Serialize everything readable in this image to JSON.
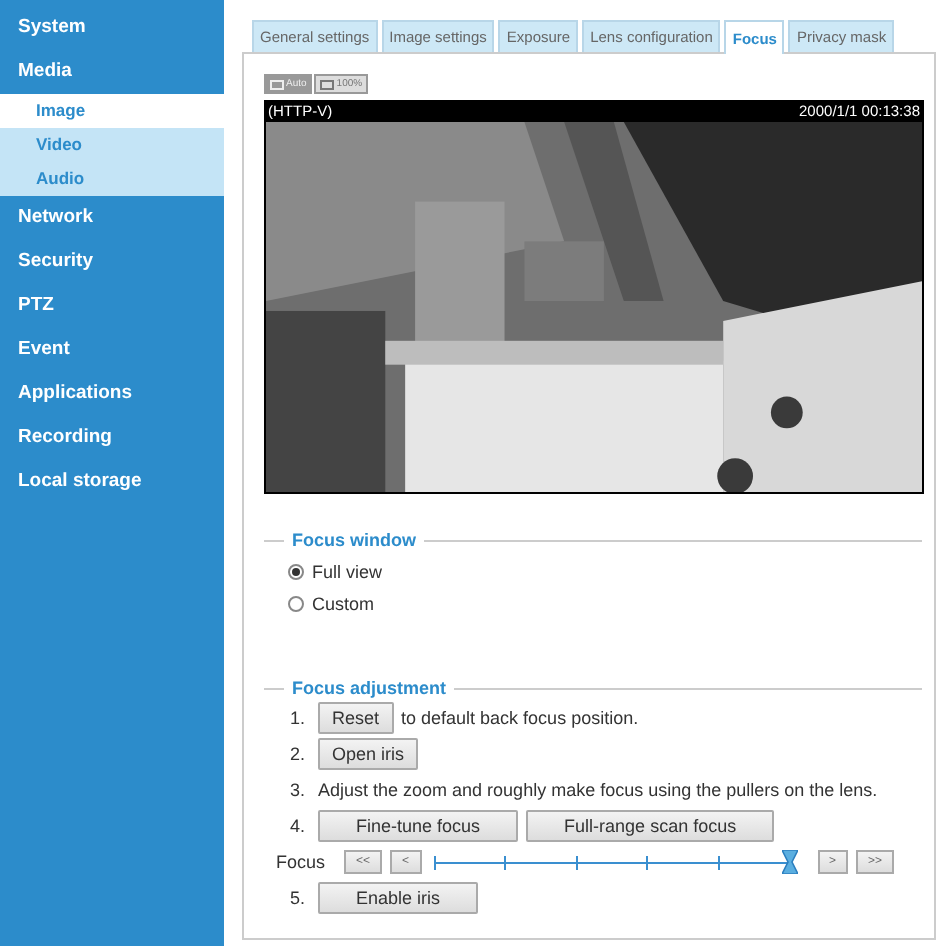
{
  "sidebar": {
    "items": [
      {
        "label": "System",
        "selected": false
      },
      {
        "label": "Media",
        "selected": false,
        "expanded": true,
        "children": [
          {
            "label": "Image",
            "selected": true
          },
          {
            "label": "Video",
            "selected": false
          },
          {
            "label": "Audio",
            "selected": false
          }
        ]
      },
      {
        "label": "Network",
        "selected": false
      },
      {
        "label": "Security",
        "selected": false
      },
      {
        "label": "PTZ",
        "selected": false
      },
      {
        "label": "Event",
        "selected": false
      },
      {
        "label": "Applications",
        "selected": false
      },
      {
        "label": "Recording",
        "selected": false
      },
      {
        "label": "Local storage",
        "selected": false
      }
    ]
  },
  "tabs": [
    {
      "label": "General settings",
      "selected": false
    },
    {
      "label": "Image settings",
      "selected": false
    },
    {
      "label": "Exposure",
      "selected": false
    },
    {
      "label": "Lens configuration",
      "selected": false
    },
    {
      "label": "Focus",
      "selected": true
    },
    {
      "label": "Privacy mask",
      "selected": false
    }
  ],
  "view_modes": [
    {
      "label": "Auto",
      "selected": true
    },
    {
      "label": "100%",
      "selected": false
    }
  ],
  "video": {
    "stream": "(HTTP-V)",
    "timestamp": "2000/1/1 00:13:38",
    "kind": "picture"
  },
  "focus_window": {
    "title": "Focus window",
    "options": [
      {
        "label": "Full view",
        "selected": true
      },
      {
        "label": "Custom",
        "selected": false
      }
    ]
  },
  "focus_adjustment": {
    "title": "Focus adjustment",
    "steps": [
      {
        "kind": "step",
        "number": "1.",
        "buttons": [
          "Reset"
        ],
        "text": "to default back focus position."
      },
      {
        "kind": "step",
        "number": "2.",
        "buttons": [
          "Open iris"
        ]
      },
      {
        "kind": "step",
        "number": "3.",
        "text": "Adjust the zoom and roughly make focus using the pullers on the lens."
      },
      {
        "kind": "step",
        "number": "4.",
        "buttons": [
          "Fine-tune focus",
          "Full-range scan focus"
        ]
      },
      {
        "kind": "slider",
        "label": "Focus",
        "left_buttons": [
          "<<",
          "<"
        ],
        "right_buttons": [
          ">",
          ">>"
        ],
        "level": 1
      },
      {
        "kind": "step",
        "number": "5.",
        "buttons": [
          "Enable iris"
        ]
      }
    ]
  }
}
